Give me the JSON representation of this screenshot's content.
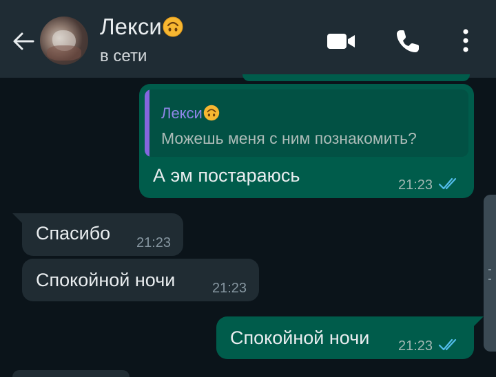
{
  "header": {
    "contact_name": "Лекси",
    "status": "в сети",
    "icons": [
      "back-arrow-icon",
      "video-call-icon",
      "phone-icon",
      "more-vert-icon"
    ]
  },
  "messages": [
    {
      "direction": "out",
      "reply_to": {
        "name": "Лекси",
        "text": "Можешь меня с ним познакомить?"
      },
      "text": "А эм постараюсь",
      "time": "21:23",
      "status": "read"
    },
    {
      "direction": "in",
      "text": "Спасибо",
      "time": "21:23"
    },
    {
      "direction": "in",
      "text": "Спокойной ночи",
      "time": "21:23"
    },
    {
      "direction": "out",
      "text": "Спокойной ночи",
      "time": "21:23",
      "status": "read"
    }
  ],
  "colors": {
    "header_bg": "#1f2c34",
    "chat_bg": "#0b141a",
    "outgoing_bubble": "#005c4b",
    "incoming_bubble": "#202c33",
    "read_ticks": "#53bdeb",
    "quote_name": "#8f86e8"
  }
}
